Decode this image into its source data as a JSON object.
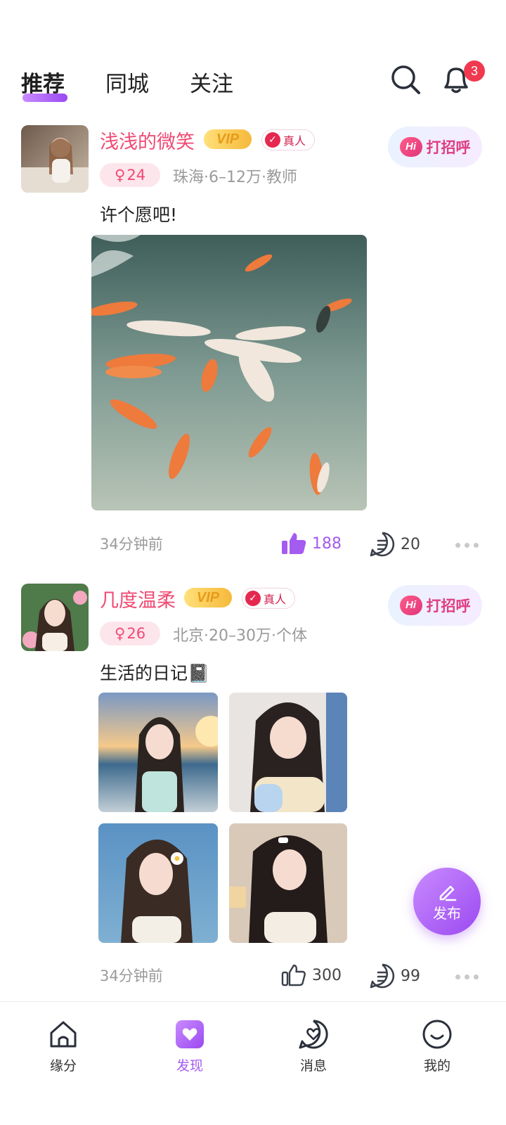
{
  "top_tabs": {
    "recommend": "推荐",
    "same_city": "同城",
    "following": "关注"
  },
  "notifications": {
    "badge": "3"
  },
  "accent_color": "#a45bf0",
  "posts": [
    {
      "name": "浅浅的微笑",
      "vip": "VIP",
      "verified": "真人",
      "greet": "打招呼",
      "greet_hi": "Hi",
      "age": "24",
      "info": "珠海·6–12万·教师",
      "text": "许个愿吧!",
      "time": "34分钟前",
      "likes": "188",
      "comments": "20"
    },
    {
      "name": "几度温柔",
      "vip": "VIP",
      "verified": "真人",
      "greet": "打招呼",
      "greet_hi": "Hi",
      "age": "26",
      "info": "北京·20–30万·个体",
      "text": "生活的日记📓",
      "time": "34分钟前",
      "likes": "300",
      "comments": "99"
    }
  ],
  "fab": {
    "label": "发布"
  },
  "bottom_nav": {
    "items": [
      {
        "label": "缘分",
        "icon": "home-icon"
      },
      {
        "label": "发现",
        "icon": "discover-heart-icon"
      },
      {
        "label": "消息",
        "icon": "message-heart-icon"
      },
      {
        "label": "我的",
        "icon": "smile-icon"
      }
    ]
  }
}
